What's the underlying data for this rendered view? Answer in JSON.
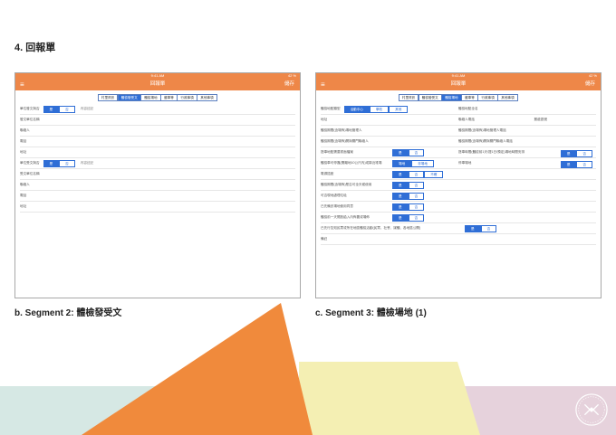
{
  "page": {
    "section_title": "4. 回報單",
    "caption_left": "b. Segment 2: 體檢發受文",
    "caption_right": "c. Segment 3: 體檢場地 (1)"
  },
  "colors": {
    "accent": "#ee8748",
    "tab_active": "#2f6ed6",
    "deco_orange": "#f08a3c",
    "deco_yellow": "#f4efb3",
    "deco_pink": "#e6d2dc",
    "deco_teal": "#d6e8e4"
  },
  "device_left": {
    "status_time": "9:41 AM",
    "status_battery": "42 %",
    "nav_title": "回報單",
    "nav_save": "儲存",
    "menu_icon": "≡",
    "tabs": [
      {
        "label": "村里資訊",
        "active": false
      },
      {
        "label": "體檢發受文",
        "active": true
      },
      {
        "label": "體檢場地",
        "active": false
      },
      {
        "label": "壅車等",
        "active": false
      },
      {
        "label": "行政事項",
        "active": false
      },
      {
        "label": "其他事項",
        "active": false
      }
    ],
    "rows": [
      {
        "label": "單位發文與否",
        "options": [
          "是",
          "否"
        ],
        "selected": 0,
        "after": "內容註記"
      },
      {
        "label": "發文單位名稱"
      },
      {
        "label": "聯絡人"
      },
      {
        "label": "電話"
      },
      {
        "label": "地址"
      },
      {
        "label": "單位受文與否",
        "options": [
          "是",
          "否"
        ],
        "selected": 0,
        "after": "內容註記"
      },
      {
        "label": "受文單位名稱"
      },
      {
        "label": "聯絡人"
      },
      {
        "label": "電話"
      },
      {
        "label": "地址"
      }
    ]
  },
  "device_right": {
    "status_time": "9:41 AM",
    "status_battery": "42 %",
    "nav_title": "回報單",
    "nav_save": "儲存",
    "menu_icon": "≡",
    "tabs": [
      {
        "label": "村里資訊",
        "active": false
      },
      {
        "label": "體檢發受文",
        "active": false
      },
      {
        "label": "體檢場地",
        "active": true
      },
      {
        "label": "壅車等",
        "active": false
      },
      {
        "label": "行政事項",
        "active": false
      },
      {
        "label": "其他事項",
        "active": false
      }
    ],
    "place_type_label": "體檢地點類型",
    "place_type_options": [
      "活動中心",
      "學校",
      "其他"
    ],
    "place_name_label": "體檢地點全名",
    "address_label": "地址",
    "contact_label": "聯絡人電話",
    "postcode_label": "郵遞區號",
    "pair_rows": [
      [
        "體檢期間(含場佈)場地管理人",
        "體檢期間(含場佈)場地管理人電話"
      ],
      [
        "體檢期間(含場佈)開與關門聯絡人",
        "體檢期間(含場佈)開與關門聯絡人電話"
      ]
    ],
    "yn_rows": [
      {
        "label": "搭車地點需要書面檔案",
        "options": [
          "是",
          "否"
        ],
        "selected": 0,
        "right_label": "搭車時間(體檢前1天/提1日/預定)場地時間安排",
        "right_options": [
          "是",
          "否"
        ],
        "right_selected": 0
      },
      {
        "label": "體檢車可停靠(需離地10公尺內)或鄰近堆場",
        "options": [
          "場地",
          "非場地"
        ],
        "selected": 0,
        "right_label": "停車場地",
        "right_options": [
          "是",
          "否"
        ],
        "right_selected": 0
      },
      {
        "label": "電源插座",
        "options": [
          "是",
          "否",
          "不確"
        ],
        "selected": 0
      },
      {
        "label": "體檢期間(含場佈)是否可全天候使用",
        "options": [
          "是",
          "否"
        ],
        "selected": 0
      },
      {
        "label": "可否現地處理垃圾",
        "options": [
          "是",
          "否"
        ],
        "selected": 0
      },
      {
        "label": "已先備妥場地使用同意",
        "options": [
          "是",
          "否"
        ],
        "selected": 0
      },
      {
        "label": "體檢前一天開放給入內佈置或場佈",
        "options": [
          "是",
          "否"
        ],
        "selected": 0
      },
      {
        "label": "已先行告知民眾或所在地區體檢活動(民眾、社會、媒體、各地區公開)",
        "options": [
          "是",
          "否"
        ],
        "selected": 0
      }
    ],
    "note_label": "備註"
  }
}
